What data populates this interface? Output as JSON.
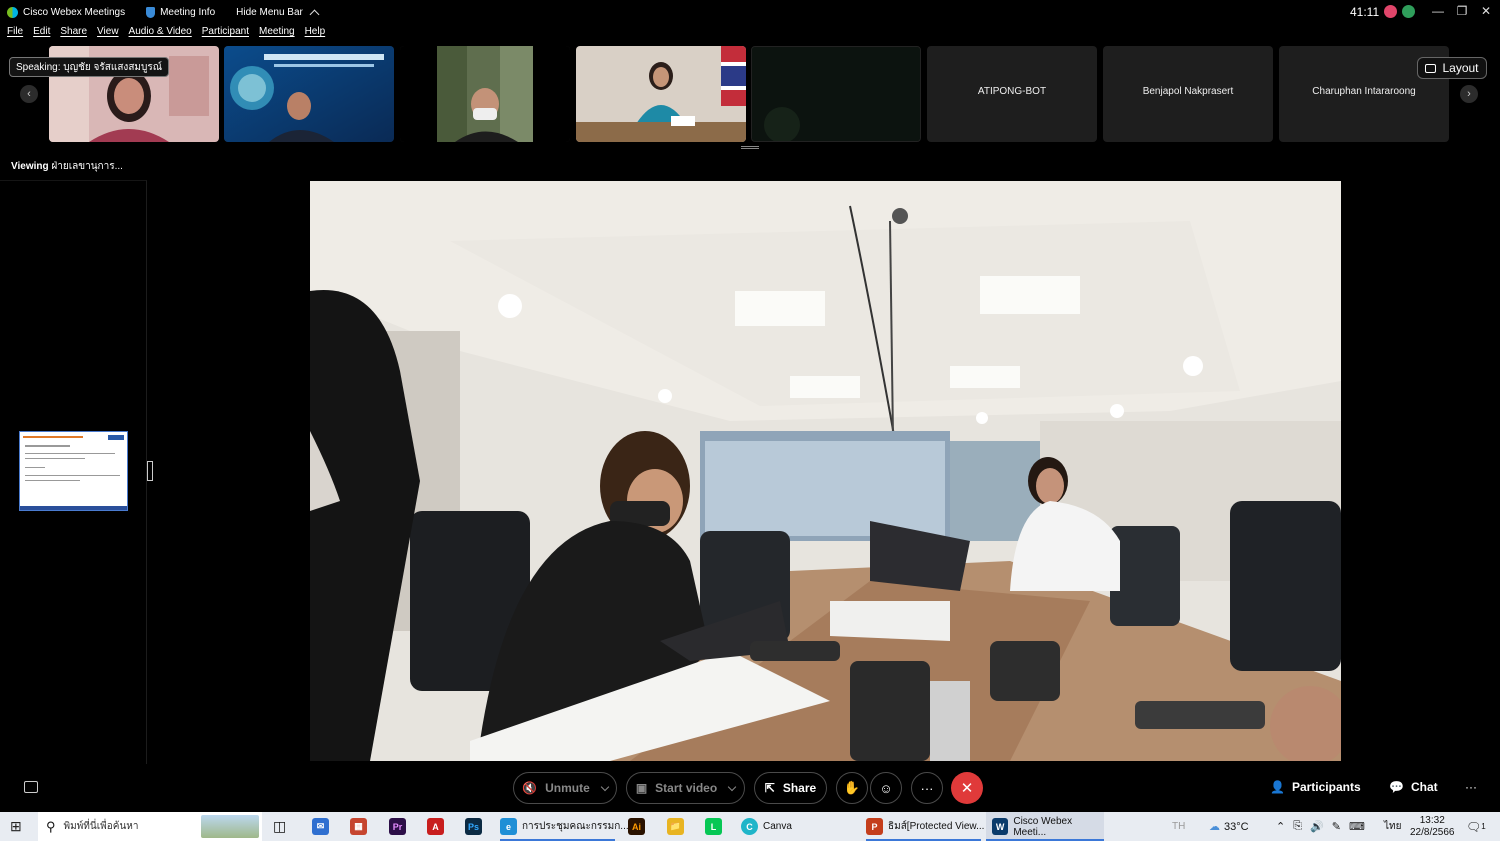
{
  "titlebar": {
    "app_name": "Cisco Webex Meetings",
    "meeting_info": "Meeting Info",
    "hide_menu": "Hide Menu Bar",
    "timer": "41:11"
  },
  "menu": [
    "File",
    "Edit",
    "Share",
    "View",
    "Audio & Video",
    "Participant",
    "Meeting",
    "Help"
  ],
  "filmstrip": {
    "speaking_label": "Speaking: บุญชัย จรัสแสงสมบูรณ์",
    "layout_label": "Layout",
    "name_tiles": [
      "ATIPONG-BOT",
      "Benjapol Nakprasert",
      "Charuphan Intararoong"
    ],
    "slide_tile_text": "โครงการพัฒนาระบบ Ministry of Agriculture and Cooperatives"
  },
  "sidebar": {
    "viewing_prefix": "Viewing",
    "viewing_name": "ฝ่ายเลขานุการ..."
  },
  "controls": {
    "unmute": "Unmute",
    "start_video": "Start video",
    "share": "Share",
    "more": "···",
    "participants": "Participants",
    "chat": "Chat",
    "overflow": "···"
  },
  "taskbar": {
    "search_placeholder": "พิมพ์ที่นี่เพื่อค้นหา",
    "edge_tab": "การประชุมคณะกรรมก...",
    "canva": "Canva",
    "ppt": "ธิมส์[Protected View...",
    "webex": "Cisco Webex Meeti...",
    "weather": "33°C",
    "lang": "ไทย",
    "ime": "TH",
    "time": "13:32",
    "date": "22/8/2566",
    "notif_count": "1"
  }
}
